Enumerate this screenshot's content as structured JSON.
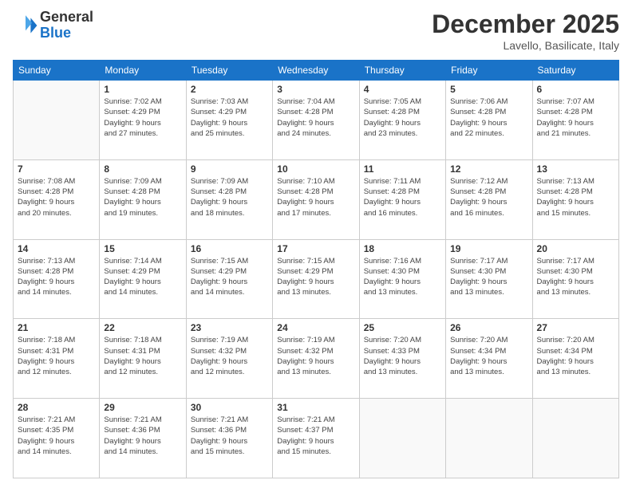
{
  "logo": {
    "general": "General",
    "blue": "Blue"
  },
  "title": "December 2025",
  "location": "Lavello, Basilicate, Italy",
  "weekdays": [
    "Sunday",
    "Monday",
    "Tuesday",
    "Wednesday",
    "Thursday",
    "Friday",
    "Saturday"
  ],
  "weeks": [
    [
      {
        "day": "",
        "info": ""
      },
      {
        "day": "1",
        "info": "Sunrise: 7:02 AM\nSunset: 4:29 PM\nDaylight: 9 hours\nand 27 minutes."
      },
      {
        "day": "2",
        "info": "Sunrise: 7:03 AM\nSunset: 4:29 PM\nDaylight: 9 hours\nand 25 minutes."
      },
      {
        "day": "3",
        "info": "Sunrise: 7:04 AM\nSunset: 4:28 PM\nDaylight: 9 hours\nand 24 minutes."
      },
      {
        "day": "4",
        "info": "Sunrise: 7:05 AM\nSunset: 4:28 PM\nDaylight: 9 hours\nand 23 minutes."
      },
      {
        "day": "5",
        "info": "Sunrise: 7:06 AM\nSunset: 4:28 PM\nDaylight: 9 hours\nand 22 minutes."
      },
      {
        "day": "6",
        "info": "Sunrise: 7:07 AM\nSunset: 4:28 PM\nDaylight: 9 hours\nand 21 minutes."
      }
    ],
    [
      {
        "day": "7",
        "info": "Sunrise: 7:08 AM\nSunset: 4:28 PM\nDaylight: 9 hours\nand 20 minutes."
      },
      {
        "day": "8",
        "info": "Sunrise: 7:09 AM\nSunset: 4:28 PM\nDaylight: 9 hours\nand 19 minutes."
      },
      {
        "day": "9",
        "info": "Sunrise: 7:09 AM\nSunset: 4:28 PM\nDaylight: 9 hours\nand 18 minutes."
      },
      {
        "day": "10",
        "info": "Sunrise: 7:10 AM\nSunset: 4:28 PM\nDaylight: 9 hours\nand 17 minutes."
      },
      {
        "day": "11",
        "info": "Sunrise: 7:11 AM\nSunset: 4:28 PM\nDaylight: 9 hours\nand 16 minutes."
      },
      {
        "day": "12",
        "info": "Sunrise: 7:12 AM\nSunset: 4:28 PM\nDaylight: 9 hours\nand 16 minutes."
      },
      {
        "day": "13",
        "info": "Sunrise: 7:13 AM\nSunset: 4:28 PM\nDaylight: 9 hours\nand 15 minutes."
      }
    ],
    [
      {
        "day": "14",
        "info": "Sunrise: 7:13 AM\nSunset: 4:28 PM\nDaylight: 9 hours\nand 14 minutes."
      },
      {
        "day": "15",
        "info": "Sunrise: 7:14 AM\nSunset: 4:29 PM\nDaylight: 9 hours\nand 14 minutes."
      },
      {
        "day": "16",
        "info": "Sunrise: 7:15 AM\nSunset: 4:29 PM\nDaylight: 9 hours\nand 14 minutes."
      },
      {
        "day": "17",
        "info": "Sunrise: 7:15 AM\nSunset: 4:29 PM\nDaylight: 9 hours\nand 13 minutes."
      },
      {
        "day": "18",
        "info": "Sunrise: 7:16 AM\nSunset: 4:30 PM\nDaylight: 9 hours\nand 13 minutes."
      },
      {
        "day": "19",
        "info": "Sunrise: 7:17 AM\nSunset: 4:30 PM\nDaylight: 9 hours\nand 13 minutes."
      },
      {
        "day": "20",
        "info": "Sunrise: 7:17 AM\nSunset: 4:30 PM\nDaylight: 9 hours\nand 13 minutes."
      }
    ],
    [
      {
        "day": "21",
        "info": "Sunrise: 7:18 AM\nSunset: 4:31 PM\nDaylight: 9 hours\nand 12 minutes."
      },
      {
        "day": "22",
        "info": "Sunrise: 7:18 AM\nSunset: 4:31 PM\nDaylight: 9 hours\nand 12 minutes."
      },
      {
        "day": "23",
        "info": "Sunrise: 7:19 AM\nSunset: 4:32 PM\nDaylight: 9 hours\nand 12 minutes."
      },
      {
        "day": "24",
        "info": "Sunrise: 7:19 AM\nSunset: 4:32 PM\nDaylight: 9 hours\nand 13 minutes."
      },
      {
        "day": "25",
        "info": "Sunrise: 7:20 AM\nSunset: 4:33 PM\nDaylight: 9 hours\nand 13 minutes."
      },
      {
        "day": "26",
        "info": "Sunrise: 7:20 AM\nSunset: 4:34 PM\nDaylight: 9 hours\nand 13 minutes."
      },
      {
        "day": "27",
        "info": "Sunrise: 7:20 AM\nSunset: 4:34 PM\nDaylight: 9 hours\nand 13 minutes."
      }
    ],
    [
      {
        "day": "28",
        "info": "Sunrise: 7:21 AM\nSunset: 4:35 PM\nDaylight: 9 hours\nand 14 minutes."
      },
      {
        "day": "29",
        "info": "Sunrise: 7:21 AM\nSunset: 4:36 PM\nDaylight: 9 hours\nand 14 minutes."
      },
      {
        "day": "30",
        "info": "Sunrise: 7:21 AM\nSunset: 4:36 PM\nDaylight: 9 hours\nand 15 minutes."
      },
      {
        "day": "31",
        "info": "Sunrise: 7:21 AM\nSunset: 4:37 PM\nDaylight: 9 hours\nand 15 minutes."
      },
      {
        "day": "",
        "info": ""
      },
      {
        "day": "",
        "info": ""
      },
      {
        "day": "",
        "info": ""
      }
    ]
  ]
}
